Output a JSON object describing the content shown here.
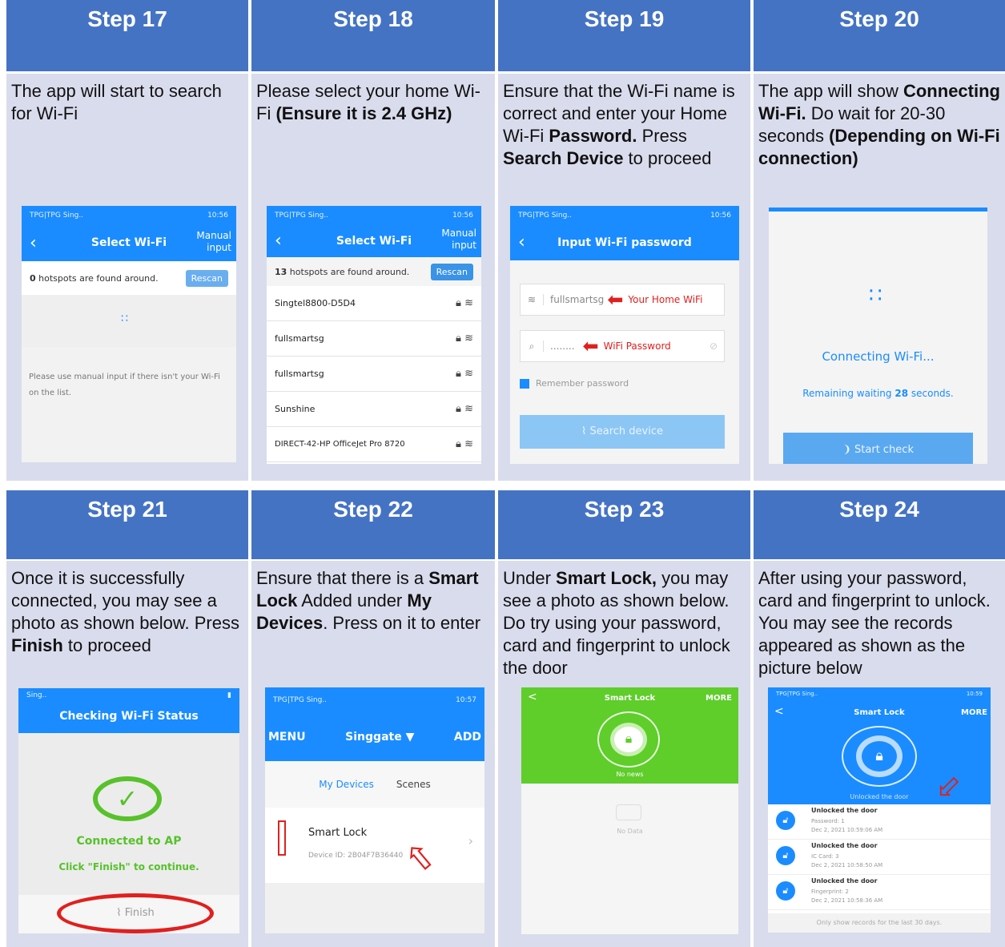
{
  "steps": [
    {
      "title": "Step 17"
    },
    {
      "title": "Step 18"
    },
    {
      "title": "Step 19"
    },
    {
      "title": "Step 20"
    },
    {
      "title": "Step 21"
    },
    {
      "title": "Step 22"
    },
    {
      "title": "Step 23"
    },
    {
      "title": "Step 24"
    }
  ],
  "desc": {
    "s17": "The app will start to search for Wi-Fi",
    "s18a": "Please select your home Wi-Fi ",
    "s18b": "(Ensure it is 2.4 GHz)",
    "s19a": "Ensure that the Wi-Fi name is correct and enter your Home Wi-Fi ",
    "s19b": "Password.",
    "s19c": " Press ",
    "s19d": "Search Device",
    "s19e": " to proceed",
    "s20a": "The app will show ",
    "s20b": "Connecting Wi-Fi.",
    "s20c": " Do wait for 20-30 seconds ",
    "s20d": "(Depending on Wi-Fi connection)",
    "s21a": "Once it is successfully connected, you may see a photo as shown below. Press ",
    "s21b": "Finish",
    "s21c": " to proceed",
    "s22a": "Ensure that there is a ",
    "s22b": "Smart Lock",
    "s22c": " Added under ",
    "s22d": "My Devices",
    "s22e": ". Press on it to enter",
    "s23a": "Under ",
    "s23b": "Smart Lock,",
    "s23c": " you may see a photo as shown below. Do try using your password, card and fingerprint to unlock the door",
    "s24": "After using your password, card and fingerprint to unlock. You may see the records appeared as shown as the picture below"
  },
  "p17": {
    "status_left": "TPG|TPG Sing..",
    "status_right": "10:56",
    "title": "Select Wi-Fi",
    "manual": "Manual input",
    "found_count": "0",
    "found_text": " hotspots are found around.",
    "rescan": "Rescan",
    "hint": "Please use manual input if there isn't your Wi-Fi on the list."
  },
  "p18": {
    "status_left": "TPG|TPG Sing..",
    "status_right": "10:56",
    "title": "Select Wi-Fi",
    "manual": "Manual input",
    "found_count": "13",
    "found_text": " hotspots are found around.",
    "rescan": "Rescan",
    "networks": [
      "Singtel8800-D5D4",
      "fullsmartsg",
      "fullsmartsg",
      "Sunshine",
      "DIRECT-42-HP OfficeJet Pro 8720"
    ]
  },
  "p19": {
    "status_left": "TPG|TPG Sing..",
    "status_right": "10:56",
    "title": "Input Wi-Fi password",
    "ssid": "fullsmartsg",
    "ssid_label": "Your Home WiFi",
    "pwd": "........",
    "pwd_label": "WiFi Password",
    "remember": "Remember password",
    "search": "Search device"
  },
  "p20": {
    "connecting": "Connecting Wi-Fi...",
    "remaining_a": "Remaining waiting ",
    "remaining_n": "28",
    "remaining_b": " seconds.",
    "start": "Start check"
  },
  "p21": {
    "status_left": "Sing..",
    "title": "Checking Wi-Fi Status",
    "connected": "Connected to AP",
    "click": "Click \"Finish\" to continue.",
    "finish": "Finish"
  },
  "p22": {
    "status_left": "TPG|TPG Sing..",
    "status_right": "10:57",
    "menu": "MENU",
    "home": "Singgate ▼",
    "add": "ADD",
    "tab1": "My Devices",
    "tab2": "Scenes",
    "device": "Smart Lock",
    "device_id": "Device ID: 2B04F7B36440"
  },
  "p23": {
    "title": "Smart Lock",
    "more": "MORE",
    "news": "No news",
    "nodata": "No Data"
  },
  "p24": {
    "status_left": "TPG|TPG Sing..",
    "status_right": "10:59",
    "title": "Smart Lock",
    "more": "MORE",
    "unlocked": "Unlocked the door",
    "records": [
      {
        "title": "Unlocked the door",
        "method": "Password: 1",
        "time": "Dec 2, 2021 10:59:06 AM"
      },
      {
        "title": "Unlocked the door",
        "method": "IC Card: 3",
        "time": "Dec 2, 2021 10:58:50 AM"
      },
      {
        "title": "Unlocked the door",
        "method": "Fingerprint: 2",
        "time": "Dec 2, 2021 10:58:36 AM"
      }
    ],
    "footer": "Only show records for the last 30 days."
  },
  "colors": {
    "header": "#4573c4",
    "cell": "#d9dcec",
    "app_blue": "#1a8cff",
    "lock_green": "#5fcd2a",
    "ok_green": "#57c22a",
    "annot_red": "#e0201e"
  }
}
